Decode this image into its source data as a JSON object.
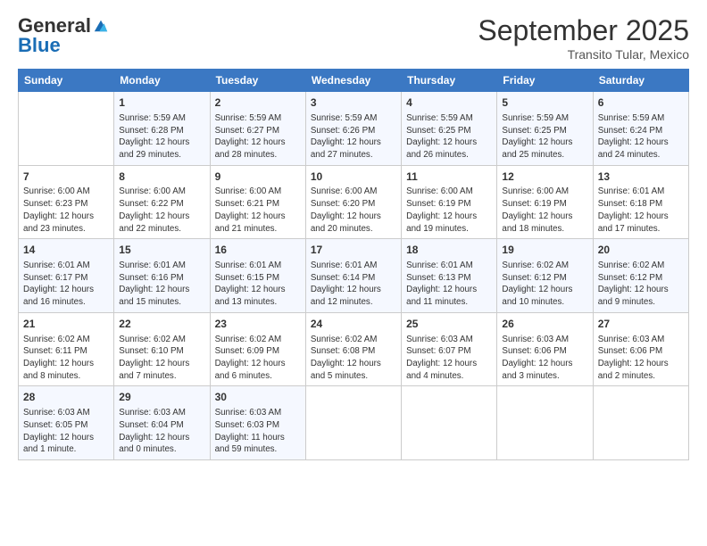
{
  "logo": {
    "general": "General",
    "blue": "Blue"
  },
  "header": {
    "month": "September 2025",
    "location": "Transito Tular, Mexico"
  },
  "weekdays": [
    "Sunday",
    "Monday",
    "Tuesday",
    "Wednesday",
    "Thursday",
    "Friday",
    "Saturday"
  ],
  "weeks": [
    [
      {
        "day": "",
        "info": ""
      },
      {
        "day": "1",
        "info": "Sunrise: 5:59 AM\nSunset: 6:28 PM\nDaylight: 12 hours\nand 29 minutes."
      },
      {
        "day": "2",
        "info": "Sunrise: 5:59 AM\nSunset: 6:27 PM\nDaylight: 12 hours\nand 28 minutes."
      },
      {
        "day": "3",
        "info": "Sunrise: 5:59 AM\nSunset: 6:26 PM\nDaylight: 12 hours\nand 27 minutes."
      },
      {
        "day": "4",
        "info": "Sunrise: 5:59 AM\nSunset: 6:25 PM\nDaylight: 12 hours\nand 26 minutes."
      },
      {
        "day": "5",
        "info": "Sunrise: 5:59 AM\nSunset: 6:25 PM\nDaylight: 12 hours\nand 25 minutes."
      },
      {
        "day": "6",
        "info": "Sunrise: 5:59 AM\nSunset: 6:24 PM\nDaylight: 12 hours\nand 24 minutes."
      }
    ],
    [
      {
        "day": "7",
        "info": "Sunrise: 6:00 AM\nSunset: 6:23 PM\nDaylight: 12 hours\nand 23 minutes."
      },
      {
        "day": "8",
        "info": "Sunrise: 6:00 AM\nSunset: 6:22 PM\nDaylight: 12 hours\nand 22 minutes."
      },
      {
        "day": "9",
        "info": "Sunrise: 6:00 AM\nSunset: 6:21 PM\nDaylight: 12 hours\nand 21 minutes."
      },
      {
        "day": "10",
        "info": "Sunrise: 6:00 AM\nSunset: 6:20 PM\nDaylight: 12 hours\nand 20 minutes."
      },
      {
        "day": "11",
        "info": "Sunrise: 6:00 AM\nSunset: 6:19 PM\nDaylight: 12 hours\nand 19 minutes."
      },
      {
        "day": "12",
        "info": "Sunrise: 6:00 AM\nSunset: 6:19 PM\nDaylight: 12 hours\nand 18 minutes."
      },
      {
        "day": "13",
        "info": "Sunrise: 6:01 AM\nSunset: 6:18 PM\nDaylight: 12 hours\nand 17 minutes."
      }
    ],
    [
      {
        "day": "14",
        "info": "Sunrise: 6:01 AM\nSunset: 6:17 PM\nDaylight: 12 hours\nand 16 minutes."
      },
      {
        "day": "15",
        "info": "Sunrise: 6:01 AM\nSunset: 6:16 PM\nDaylight: 12 hours\nand 15 minutes."
      },
      {
        "day": "16",
        "info": "Sunrise: 6:01 AM\nSunset: 6:15 PM\nDaylight: 12 hours\nand 13 minutes."
      },
      {
        "day": "17",
        "info": "Sunrise: 6:01 AM\nSunset: 6:14 PM\nDaylight: 12 hours\nand 12 minutes."
      },
      {
        "day": "18",
        "info": "Sunrise: 6:01 AM\nSunset: 6:13 PM\nDaylight: 12 hours\nand 11 minutes."
      },
      {
        "day": "19",
        "info": "Sunrise: 6:02 AM\nSunset: 6:12 PM\nDaylight: 12 hours\nand 10 minutes."
      },
      {
        "day": "20",
        "info": "Sunrise: 6:02 AM\nSunset: 6:12 PM\nDaylight: 12 hours\nand 9 minutes."
      }
    ],
    [
      {
        "day": "21",
        "info": "Sunrise: 6:02 AM\nSunset: 6:11 PM\nDaylight: 12 hours\nand 8 minutes."
      },
      {
        "day": "22",
        "info": "Sunrise: 6:02 AM\nSunset: 6:10 PM\nDaylight: 12 hours\nand 7 minutes."
      },
      {
        "day": "23",
        "info": "Sunrise: 6:02 AM\nSunset: 6:09 PM\nDaylight: 12 hours\nand 6 minutes."
      },
      {
        "day": "24",
        "info": "Sunrise: 6:02 AM\nSunset: 6:08 PM\nDaylight: 12 hours\nand 5 minutes."
      },
      {
        "day": "25",
        "info": "Sunrise: 6:03 AM\nSunset: 6:07 PM\nDaylight: 12 hours\nand 4 minutes."
      },
      {
        "day": "26",
        "info": "Sunrise: 6:03 AM\nSunset: 6:06 PM\nDaylight: 12 hours\nand 3 minutes."
      },
      {
        "day": "27",
        "info": "Sunrise: 6:03 AM\nSunset: 6:06 PM\nDaylight: 12 hours\nand 2 minutes."
      }
    ],
    [
      {
        "day": "28",
        "info": "Sunrise: 6:03 AM\nSunset: 6:05 PM\nDaylight: 12 hours\nand 1 minute."
      },
      {
        "day": "29",
        "info": "Sunrise: 6:03 AM\nSunset: 6:04 PM\nDaylight: 12 hours\nand 0 minutes."
      },
      {
        "day": "30",
        "info": "Sunrise: 6:03 AM\nSunset: 6:03 PM\nDaylight: 11 hours\nand 59 minutes."
      },
      {
        "day": "",
        "info": ""
      },
      {
        "day": "",
        "info": ""
      },
      {
        "day": "",
        "info": ""
      },
      {
        "day": "",
        "info": ""
      }
    ]
  ]
}
